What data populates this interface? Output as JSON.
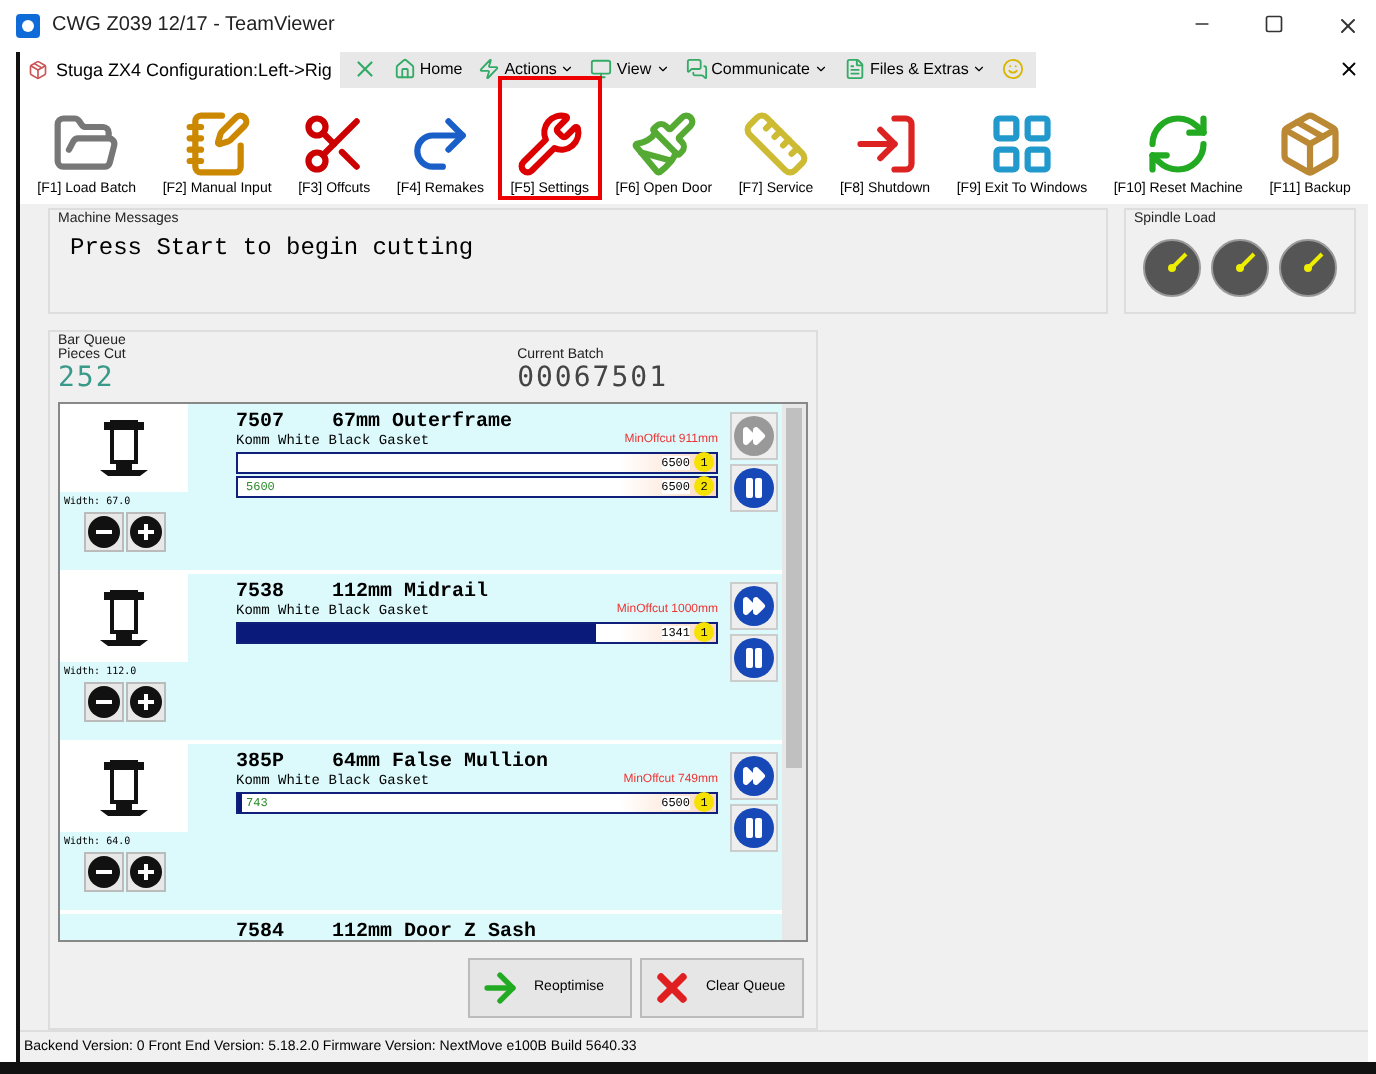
{
  "window": {
    "title": "CWG Z039 12/17 - TeamViewer"
  },
  "app_tab": {
    "title": "Stuga ZX4  Configuration:Left->Rig"
  },
  "remote_toolbar": [
    {
      "kind": "close"
    },
    {
      "kind": "home",
      "label": "Home"
    },
    {
      "kind": "actions",
      "label": "Actions"
    },
    {
      "kind": "view",
      "label": "View"
    },
    {
      "kind": "communicate",
      "label": "Communicate"
    },
    {
      "kind": "files",
      "label": "Files & Extras"
    },
    {
      "kind": "smiley"
    }
  ],
  "toolbar": [
    {
      "kind": "load",
      "label": "[F1] Load Batch",
      "highlighted": false
    },
    {
      "kind": "manual",
      "label": "[F2] Manual Input",
      "highlighted": false
    },
    {
      "kind": "offcuts",
      "label": "[F3] Offcuts",
      "highlighted": false
    },
    {
      "kind": "remakes",
      "label": "[F4] Remakes",
      "highlighted": false
    },
    {
      "kind": "settings",
      "label": "[F5] Settings",
      "highlighted": true
    },
    {
      "kind": "door",
      "label": "[F6] Open Door",
      "highlighted": false
    },
    {
      "kind": "service",
      "label": "[F7] Service",
      "highlighted": false
    },
    {
      "kind": "shutdown",
      "label": "[F8] Shutdown",
      "highlighted": false
    },
    {
      "kind": "exit",
      "label": "[F9] Exit To Windows",
      "highlighted": false
    },
    {
      "kind": "reset",
      "label": "[F10] Reset Machine",
      "highlighted": false
    },
    {
      "kind": "backup",
      "label": "[F11] Backup",
      "highlighted": false
    }
  ],
  "machine_messages": {
    "title": "Machine Messages",
    "text": "Press Start to begin cutting"
  },
  "spindle_load": {
    "title": "Spindle Load"
  },
  "bar_queue": {
    "title": "Bar Queue",
    "pieces_cut_label": "Pieces Cut",
    "pieces_cut": "252",
    "current_batch_label": "Current Batch",
    "current_batch": "00067501",
    "items": [
      {
        "id": "7507",
        "name": "67mm Outerframe",
        "material": "Komm White Black Gasket",
        "min_offcut": "MinOffcut 911mm",
        "width": "Width: 67.0",
        "forward_disabled": true,
        "bars": [
          {
            "level": 0,
            "remaining": "6500",
            "number": "1"
          },
          {
            "level": 0,
            "cut": "5600",
            "remaining": "6500",
            "number": "2"
          }
        ]
      },
      {
        "id": "7538",
        "name": "112mm Midrail",
        "material": "Komm White Black Gasket",
        "min_offcut": "MinOffcut 1000mm",
        "width": "Width: 112.0",
        "forward_disabled": false,
        "bars": [
          {
            "level": 0.75,
            "remaining": "1341",
            "number": "1"
          }
        ]
      },
      {
        "id": "385P",
        "name": "64mm False Mullion",
        "material": "Komm White Black Gasket",
        "min_offcut": "MinOffcut 749mm",
        "width": "Width: 64.0",
        "forward_disabled": false,
        "bars": [
          {
            "level": 0.01,
            "cut": "743",
            "remaining": "6500",
            "number": "1"
          }
        ]
      },
      {
        "id": "7584",
        "name": "112mm Door Z Sash"
      }
    ],
    "buttons": [
      {
        "kind": "reoptimise",
        "label": "Reoptimise"
      },
      {
        "kind": "clear",
        "label": "Clear Queue"
      }
    ]
  },
  "status_bar": "Backend Version: 0  Front End Version: 5.18.2.0  Firmware Version: NextMove e100B Build 5640.33"
}
